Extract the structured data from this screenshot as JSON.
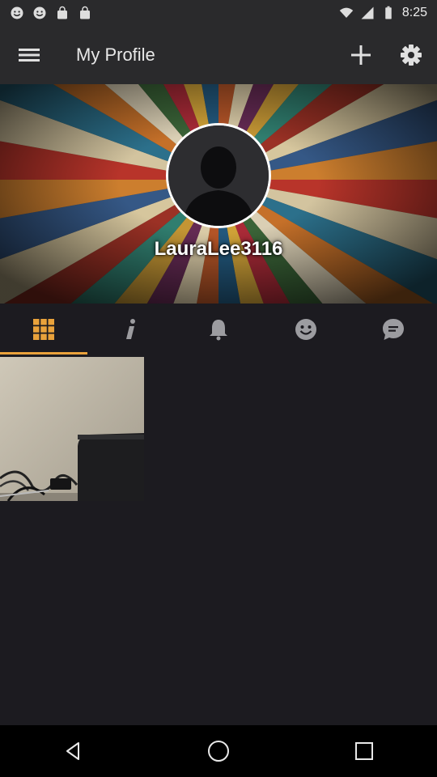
{
  "status_bar": {
    "time": "8:25",
    "left_icons": [
      "emoji-icon",
      "emoji-icon",
      "shopping-bag-icon",
      "shopping-bag-icon"
    ],
    "right_icons": [
      "wifi-icon",
      "signal-icon",
      "battery-icon"
    ]
  },
  "app_bar": {
    "title": "My Profile",
    "menu_icon": "menu-icon",
    "add_icon": "plus-icon",
    "settings_icon": "gear-icon"
  },
  "profile": {
    "username": "LauraLee3116",
    "avatar_icon": "person-silhouette-icon"
  },
  "tabs": [
    {
      "name": "grid",
      "icon": "grid-icon",
      "active": true
    },
    {
      "name": "info",
      "icon": "info-icon",
      "active": false
    },
    {
      "name": "notifications",
      "icon": "bell-icon",
      "active": false
    },
    {
      "name": "reactions",
      "icon": "smiley-icon",
      "active": false
    },
    {
      "name": "messages",
      "icon": "chat-icon",
      "active": false
    }
  ],
  "colors": {
    "accent": "#e9a23b",
    "app_bar_bg": "#2a2a2c",
    "content_bg": "#1c1b20",
    "icon_gray": "#9c9ca0"
  },
  "photos": [
    {
      "description_icon": "photo-thumbnail"
    }
  ],
  "nav_bar": {
    "buttons": [
      "back-icon",
      "home-icon",
      "recents-icon"
    ]
  }
}
